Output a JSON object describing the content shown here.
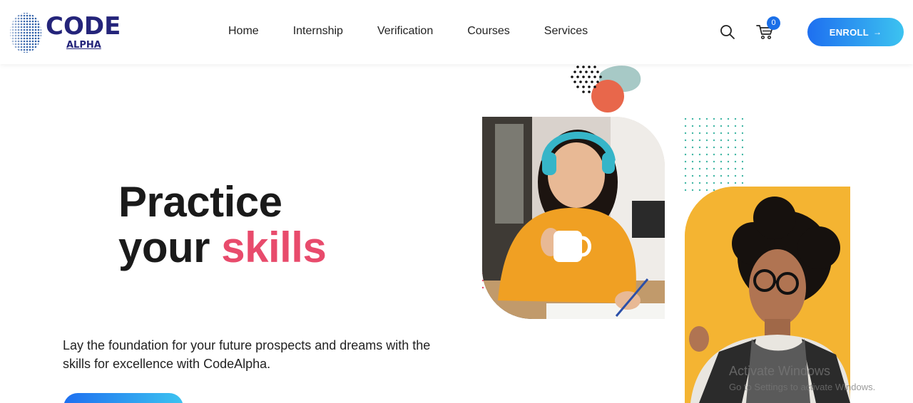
{
  "brand": {
    "name": "CODE",
    "subname": "ALPHA"
  },
  "nav": {
    "items": [
      {
        "label": "Home"
      },
      {
        "label": "Internship"
      },
      {
        "label": "Verification"
      },
      {
        "label": "Courses"
      },
      {
        "label": "Services"
      }
    ]
  },
  "header_actions": {
    "search_icon": "search-icon",
    "cart_icon": "cart-icon",
    "cart_count": "0",
    "enroll_label": "ENROLL",
    "enroll_arrow": "→"
  },
  "hero": {
    "title_line1": "Practice",
    "title_line2_plain": "your",
    "title_line2_accent": "skills",
    "description": "Lay the foundation for your future prospects and dreams with the skills for excellence with CodeAlpha."
  },
  "system_watermark": {
    "line1": "Activate Windows",
    "line2": "Go to Settings to activate Windows."
  },
  "colors": {
    "brand_navy": "#24247a",
    "accent_pink": "#e84b6c",
    "button_gradient_start": "#1e6ff0",
    "button_gradient_end": "#3cc3f0",
    "badge_blue": "#1a6fe8",
    "photo2_background": "#f4b432"
  }
}
